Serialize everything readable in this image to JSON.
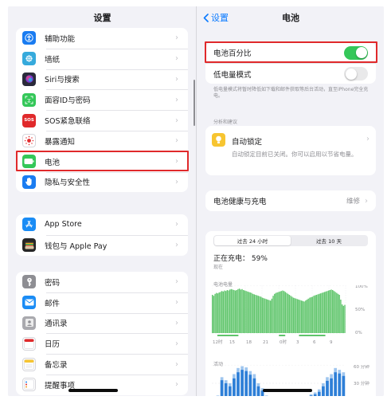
{
  "colors": {
    "accent": "#0a7aff",
    "toggle_on": "#34c759",
    "highlight": "#e0292b",
    "chart_green": "#5fc56b",
    "chart_blue": "#2e7fd7"
  },
  "settings": {
    "title": "设置",
    "groups": [
      [
        {
          "label": "辅助功能",
          "icon": "accessibility-icon",
          "color": "#1a7cf1"
        },
        {
          "label": "墙纸",
          "icon": "wallpaper-icon",
          "color": "#36aadc"
        },
        {
          "label": "Siri与搜索",
          "icon": "siri-icon",
          "color": "#2a2a3a"
        },
        {
          "label": "面容ID与密码",
          "icon": "face-id-icon",
          "color": "#34c759"
        },
        {
          "label": "SOS紧急联络",
          "icon": "sos-icon",
          "color": "#e0292b",
          "glyph": "SOS"
        },
        {
          "label": "暴露通知",
          "icon": "exposure-icon",
          "color": "#ffffff"
        },
        {
          "label": "电池",
          "icon": "battery-icon",
          "color": "#34c759"
        },
        {
          "label": "隐私与安全性",
          "icon": "hand-icon",
          "color": "#1a7cf1"
        }
      ],
      [
        {
          "label": "App Store",
          "icon": "app-store-icon",
          "color": "#1a8cf5"
        },
        {
          "label": "钱包与 Apple Pay",
          "icon": "wallet-icon",
          "color": "#262626"
        }
      ],
      [
        {
          "label": "密码",
          "icon": "key-icon",
          "color": "#8e8e93"
        },
        {
          "label": "邮件",
          "icon": "mail-icon",
          "color": "#1a8cf5"
        },
        {
          "label": "通讯录",
          "icon": "contacts-icon",
          "color": "#a9a9ae"
        },
        {
          "label": "日历",
          "icon": "calendar-icon",
          "color": "#ffffff"
        },
        {
          "label": "备忘录",
          "icon": "notes-icon",
          "color": "#ffffff"
        },
        {
          "label": "提醒事项",
          "icon": "reminders-icon",
          "color": "#ffffff"
        }
      ]
    ]
  },
  "battery": {
    "back_label": "设置",
    "title": "电池",
    "percentage_label": "电池百分比",
    "percentage_on": true,
    "low_power_label": "低电量模式",
    "low_power_on": false,
    "low_power_note": "低电量模式将暂时降低如下载和邮件获取等后台活动，直至iPhone完全充电。",
    "insights_header": "分析和建议",
    "auto_lock_title": "自动锁定",
    "auto_lock_desc": "自动锁定目前已关闭。你可以启用以节省电量。",
    "health_label": "电池健康与充电",
    "health_value": "维修",
    "tabs": [
      "过去 24 小时",
      "过去 10 天"
    ],
    "charging_text": "正在充电：  59%",
    "now_text": "现在",
    "level_label": "电池电量",
    "activity_label": "活动"
  },
  "chart_data": [
    {
      "type": "area",
      "title": "电池电量",
      "x_ticks": [
        "12时",
        "15",
        "18",
        "21",
        "0时",
        "3",
        "6",
        "9"
      ],
      "y_ticks": [
        "100%",
        "50%",
        "0%"
      ],
      "ylim": [
        0,
        100
      ],
      "values": [
        80,
        78,
        82,
        84,
        83,
        85,
        86,
        88,
        87,
        89,
        88,
        90,
        89,
        91,
        92,
        91,
        90,
        89,
        90,
        92,
        93,
        91,
        92,
        90,
        89,
        88,
        87,
        86,
        85,
        84,
        82,
        81,
        80,
        79,
        78,
        77,
        76,
        74,
        73,
        72,
        71,
        70,
        69,
        68,
        72,
        78,
        82,
        84,
        85,
        86,
        87,
        88,
        89,
        88,
        86,
        84,
        82,
        80,
        78,
        76,
        74,
        73,
        72,
        71,
        70,
        69,
        68,
        67,
        66,
        68,
        70,
        72,
        74,
        75,
        76,
        78,
        79,
        80,
        81,
        82,
        83,
        84,
        85,
        86,
        87,
        88,
        89,
        90,
        91,
        90,
        88,
        86,
        84,
        82,
        80,
        70,
        60,
        57,
        59
      ],
      "charging_segments": [
        [
          0.04,
          0.2
        ],
        [
          0.5,
          0.55
        ],
        [
          0.65,
          0.85
        ]
      ]
    },
    {
      "type": "bar",
      "title": "活动",
      "y_ticks": [
        "60 分钟",
        "30 分钟"
      ],
      "ylim": [
        0,
        60
      ],
      "values": [
        0,
        10,
        40,
        35,
        30,
        45,
        55,
        58,
        56,
        50,
        45,
        30,
        22,
        10,
        5,
        4,
        3,
        2,
        3,
        4,
        3,
        2,
        5,
        8,
        12,
        15,
        20,
        30,
        40,
        45,
        55,
        52,
        48
      ],
      "screen_on": [
        0,
        8,
        35,
        30,
        25,
        38,
        48,
        52,
        50,
        44,
        38,
        25,
        18,
        8,
        3,
        3,
        2,
        2,
        2,
        3,
        2,
        2,
        4,
        6,
        10,
        12,
        16,
        25,
        34,
        38,
        48,
        46,
        42
      ]
    }
  ]
}
